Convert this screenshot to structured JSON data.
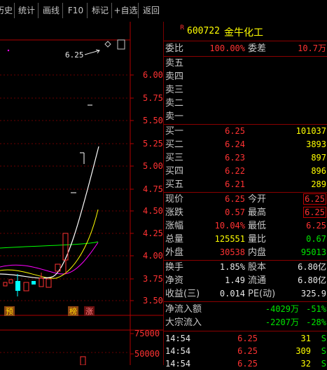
{
  "toolbar": {
    "buttons": [
      "历史",
      "统计",
      "画线",
      "F10",
      "标记",
      "+自选",
      "返回"
    ]
  },
  "chart": {
    "price_ticks": [
      "6.00",
      "5.75",
      "5.50",
      "5.25",
      "5.00",
      "4.75",
      "4.50",
      "4.25",
      "4.00",
      "3.75",
      "3.50"
    ],
    "last_price_label": "6.25",
    "markers": [
      "预",
      "榜",
      "涨"
    ],
    "volume_ticks": [
      "75000",
      "50000"
    ],
    "colors": {
      "up": "#ff3232",
      "down": "#00ffff",
      "ma5": "#ffffff",
      "ma10": "#ffff00",
      "ma20": "#ff00ff",
      "ma60": "#00ff00",
      "axis": "#b00000"
    }
  },
  "stock": {
    "r_tag": "R",
    "code": "600722",
    "name": "金牛化工"
  },
  "commission": {
    "ratio_label": "委比",
    "ratio_value": "100.00%",
    "diff_label": "委差",
    "diff_value": "10.7万"
  },
  "sell_orders": [
    {
      "label": "卖五",
      "price": "",
      "volume": ""
    },
    {
      "label": "卖四",
      "price": "",
      "volume": ""
    },
    {
      "label": "卖三",
      "price": "",
      "volume": ""
    },
    {
      "label": "卖二",
      "price": "",
      "volume": ""
    },
    {
      "label": "卖一",
      "price": "",
      "volume": ""
    }
  ],
  "buy_orders": [
    {
      "label": "买一",
      "price": "6.25",
      "volume": "101037"
    },
    {
      "label": "买二",
      "price": "6.24",
      "volume": "3893"
    },
    {
      "label": "买三",
      "price": "6.23",
      "volume": "897"
    },
    {
      "label": "买四",
      "price": "6.22",
      "volume": "896"
    },
    {
      "label": "买五",
      "price": "6.21",
      "volume": "289"
    }
  ],
  "quote": [
    {
      "l1": "现价",
      "v1": "6.25",
      "l2": "今开",
      "v2": "6.25"
    },
    {
      "l1": "涨跌",
      "v1": "0.57",
      "l2": "最高",
      "v2": "6.25"
    },
    {
      "l1": "涨幅",
      "v1": "10.04%",
      "l2": "最低",
      "v2": "6.25"
    },
    {
      "l1": "总量",
      "v1": "125551",
      "l2": "量比",
      "v2": "0.67"
    },
    {
      "l1": "外盘",
      "v1": "30538",
      "l2": "内盘",
      "v2": "95013"
    }
  ],
  "fundamentals": [
    {
      "l1": "换手",
      "v1": "1.85%",
      "l2": "股本",
      "v2": "6.80亿"
    },
    {
      "l1": "净资",
      "v1": "1.49",
      "l2": "流通",
      "v2": "6.80亿"
    },
    {
      "l1": "收益(三)",
      "v1": "0.014",
      "l2": "PE(动)",
      "v2": "325.9"
    }
  ],
  "flows": [
    {
      "label": "净流入额",
      "value": "-4029万",
      "pct": "-51%"
    },
    {
      "label": "大宗流入",
      "value": "-2207万",
      "pct": "-28%"
    }
  ],
  "ticks": [
    {
      "time": "14:54",
      "price": "6.25",
      "volume": "31",
      "side": "S"
    },
    {
      "time": "14:54",
      "price": "6.25",
      "volume": "309",
      "side": "S"
    },
    {
      "time": "14:54",
      "price": "6.25",
      "volume": "32",
      "side": "S"
    }
  ]
}
